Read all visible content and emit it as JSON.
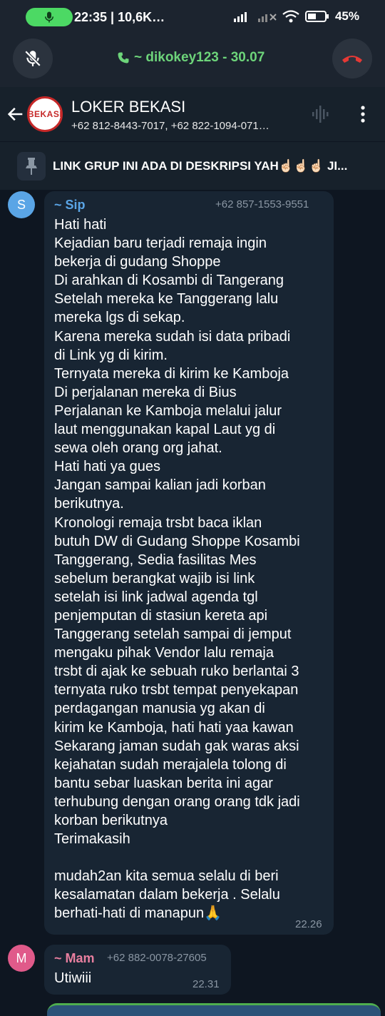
{
  "status": {
    "time": "22:35 | 10,6K…",
    "battery": "45%"
  },
  "call": {
    "label": "~ dikokey123 - 30.07"
  },
  "header": {
    "title": "LOKER BEKASI",
    "members": "+62 812-8443-7017, +62 822-1094-071…",
    "avatar_text": "BEKASI"
  },
  "pinned": {
    "text": "LINK GRUP INI ADA DI DESKRIPSI YAH☝🏻☝🏻☝🏻 JI..."
  },
  "messages": [
    {
      "avatar_letter": "S",
      "avatar_color": "#5aa5e6",
      "sender": "~ Sip",
      "sender_color": "#5aa5e6",
      "phone": "+62 857-1553-9551",
      "text": "Hati hati\nKejadian baru terjadi remaja ingin\nbekerja di gudang Shoppe\nDi arahkan di Kosambi di Tangerang\nSetelah mereka ke Tanggerang lalu\nmereka lgs di sekap.\nKarena mereka sudah isi data pribadi\ndi Link yg di kirim.\nTernyata mereka di kirim ke Kamboja\nDi perjalanan mereka di Bius\nPerjalanan ke Kamboja melalui jalur\nlaut menggunakan kapal Laut yg di\nsewa oleh orang org jahat.\nHati hati ya gues\nJangan sampai kalian jadi korban\nberikutnya.\nKronologi remaja trsbt baca iklan\nbutuh DW di Gudang Shoppe  Kosambi\nTanggerang, Sedia fasilitas Mes\nsebelum berangkat wajib isi link\nsetelah isi link jadwal agenda tgl\npenjemputan di stasiun kereta api\nTanggerang setelah sampai di jemput\nmengaku pihak Vendor lalu remaja\ntrsbt di ajak ke sebuah ruko berlantai 3\nternyata ruko trsbt tempat penyekapan\nperdagangan manusia yg akan di\nkirim ke Kamboja, hati hati yaa kawan\nSekarang jaman sudah gak waras aksi\nkejahatan sudah merajalela tolong di\nbantu sebar luaskan berita ini agar\nterhubung dengan orang orang tdk jadi\nkorban berikutnya\nTerimakasih\n\n mudah2an kita semua selalu di beri\nkesalamatan dalam bekerja . Selalu\nberhati-hati di manapun🙏",
      "time": "22.26"
    },
    {
      "avatar_letter": "M",
      "avatar_color": "#e05a8a",
      "sender": "~ Mam",
      "sender_color": "#e87f9f",
      "phone": "+62 882-0078-27605",
      "text": "Utiwiii",
      "time": "22.31"
    }
  ]
}
